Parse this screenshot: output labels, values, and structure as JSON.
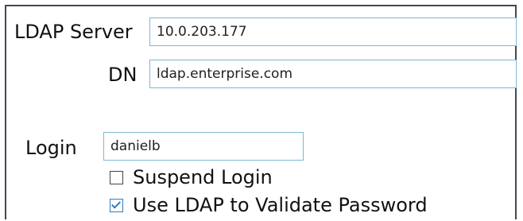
{
  "form": {
    "ldap_server": {
      "label": "LDAP Server",
      "value": "10.0.203.177"
    },
    "dn": {
      "label": "DN",
      "value": "ldap.enterprise.com"
    },
    "login": {
      "label": "Login",
      "value": "danielb"
    },
    "suspend_login": {
      "label": "Suspend Login",
      "checked": false
    },
    "use_ldap": {
      "label": "Use LDAP to Validate Password",
      "checked": true
    }
  },
  "colors": {
    "field_border": "#7eb6d4",
    "panel_border": "#3f4a57",
    "checkbox_accent": "#2d7bc4"
  }
}
